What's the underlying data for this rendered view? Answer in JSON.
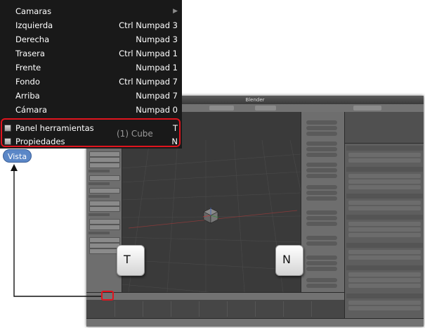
{
  "blender": {
    "title": "Blender",
    "viewport_object_label": "(1) Cube"
  },
  "menu": {
    "items": [
      {
        "label": "Camaras",
        "shortcut": "",
        "submenu": true
      },
      {
        "label": "Izquierda",
        "shortcut": "Ctrl Numpad 3"
      },
      {
        "label": "Derecha",
        "shortcut": "Numpad 3"
      },
      {
        "label": "Trasera",
        "shortcut": "Ctrl Numpad 1"
      },
      {
        "label": "Frente",
        "shortcut": "Numpad 1"
      },
      {
        "label": "Fondo",
        "shortcut": "Ctrl Numpad 7"
      },
      {
        "label": "Arriba",
        "shortcut": "Numpad 7"
      },
      {
        "label": "Cámara",
        "shortcut": "Numpad 0"
      }
    ],
    "toggles": [
      {
        "label": "Panel herramientas",
        "shortcut": "T"
      },
      {
        "label": "Propiedades",
        "shortcut": "N"
      }
    ]
  },
  "vista_button": "Vista",
  "keys": {
    "left": "T",
    "right": "N"
  },
  "colors": {
    "highlight": "#e0141e",
    "vista": "#5b87c7",
    "menu_bg": "#191919"
  }
}
